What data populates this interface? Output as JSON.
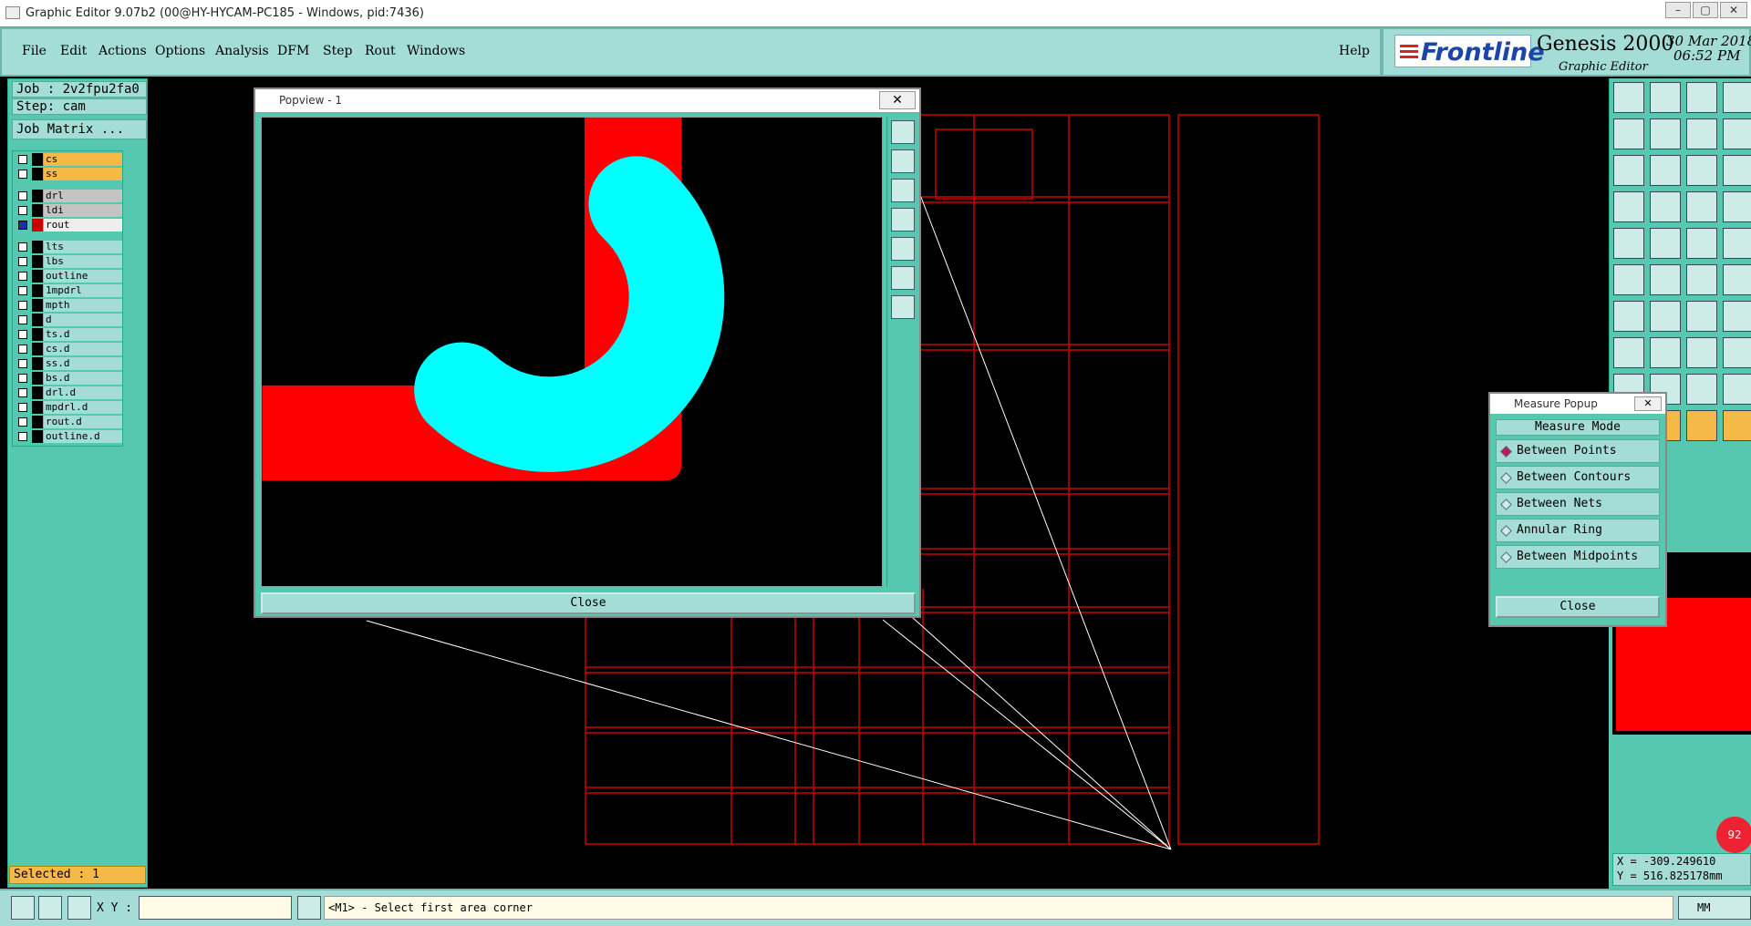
{
  "window": {
    "title": "Graphic Editor 9.07b2 (00@HY-HYCAM-PC185 - Windows, pid:7436)"
  },
  "menu": {
    "items": [
      "File",
      "Edit",
      "Actions",
      "Options",
      "Analysis",
      "DFM",
      "Step",
      "Rout",
      "Windows"
    ],
    "help": "Help"
  },
  "brand": {
    "logo": "Frontline",
    "product": "Genesis 2000",
    "subtitle": "Graphic Editor",
    "date": "30 Mar 2018",
    "time": "06:52 PM"
  },
  "job": {
    "job_label": "Job : 2v2fpu2fa0",
    "step_label": "Step: cam",
    "matrix_button": "Job Matrix ..."
  },
  "layers": [
    {
      "name": "cs",
      "style": "orange",
      "active": false
    },
    {
      "name": "ss",
      "style": "orange",
      "active": false
    },
    {
      "name": "drl",
      "style": "grey",
      "active": false
    },
    {
      "name": "ldi",
      "style": "grey",
      "active": false
    },
    {
      "name": "rout",
      "style": "white",
      "active": true
    },
    {
      "name": "lts",
      "style": "normal",
      "active": false
    },
    {
      "name": "lbs",
      "style": "normal",
      "active": false
    },
    {
      "name": "outline",
      "style": "normal",
      "active": false
    },
    {
      "name": "1mpdrl",
      "style": "normal",
      "active": false
    },
    {
      "name": "mpth",
      "style": "normal",
      "active": false
    },
    {
      "name": "d",
      "style": "normal",
      "active": false
    },
    {
      "name": "ts.d",
      "style": "normal",
      "active": false
    },
    {
      "name": "cs.d",
      "style": "normal",
      "active": false
    },
    {
      "name": "ss.d",
      "style": "normal",
      "active": false
    },
    {
      "name": "bs.d",
      "style": "normal",
      "active": false
    },
    {
      "name": "drl.d",
      "style": "normal",
      "active": false
    },
    {
      "name": "mpdrl.d",
      "style": "normal",
      "active": false
    },
    {
      "name": "rout.d",
      "style": "normal",
      "active": false
    },
    {
      "name": "outline.d",
      "style": "normal",
      "active": false
    }
  ],
  "selected": "Selected : 1",
  "popview": {
    "title": "Popview - 1",
    "close_label": "Close",
    "close_x": "✕"
  },
  "measure": {
    "title": "Measure Popup",
    "header": "Measure Mode",
    "options": [
      "Between Points",
      "Between Contours",
      "Between Nets",
      "Annular Ring",
      "Between Midpoints"
    ],
    "selected": "Between Points",
    "close_label": "Close"
  },
  "bottom": {
    "xy_label": "X Y :",
    "xy_value": "",
    "status": "<M1> - Select first area corner",
    "units": "MM"
  },
  "coords": {
    "x": "X = -309.249610",
    "y": "Y = 516.825178mm"
  },
  "badge": "92",
  "colors": {
    "panel": "#56c8b0",
    "field": "#a4dcd6",
    "highlight": "#f5b948",
    "trace_red": "#ff0000",
    "trace_cyan": "#00ffff"
  }
}
